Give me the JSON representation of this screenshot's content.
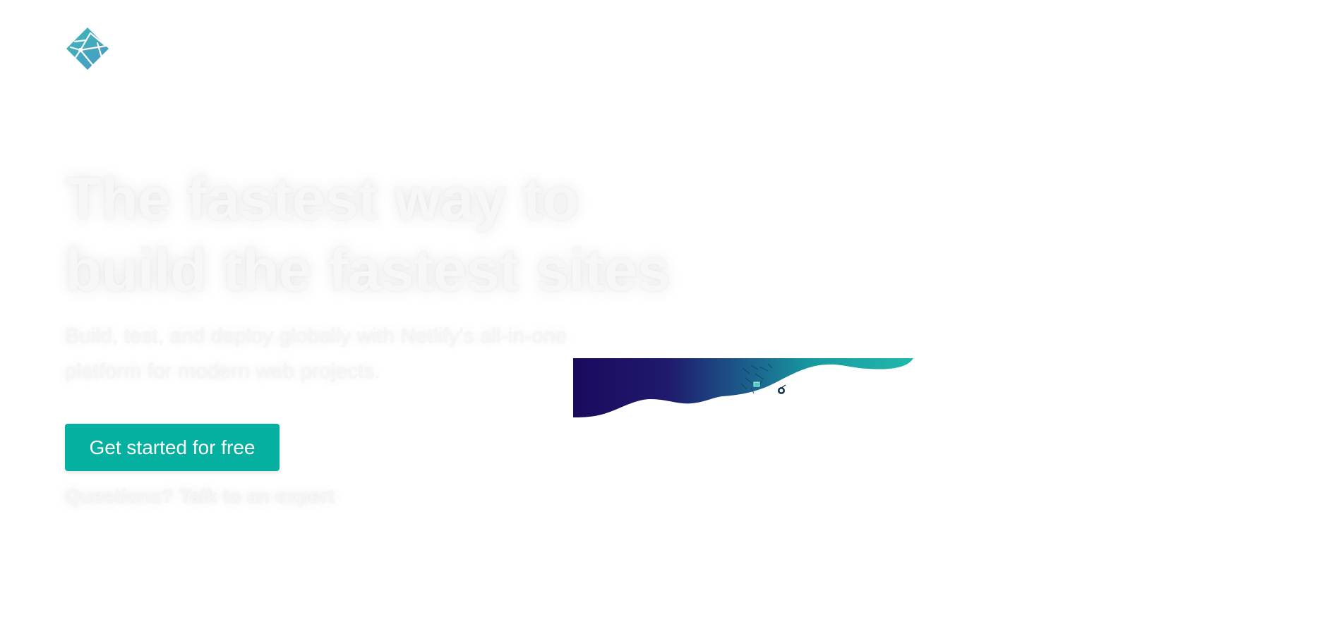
{
  "brand": {
    "logo_icon": "netlify-diamond-logo-icon",
    "primary_color": "#05b0a0",
    "logo_colors": [
      "#3fb5b8",
      "#4a9fc6"
    ]
  },
  "hero": {
    "title_line1": "The fastest way to",
    "title_line2": "build the fastest sites",
    "subtitle": "Build, test, and deploy globally with Netlify's all-in-one platform for modern web projects.",
    "cta_label": "Get started for free",
    "expert_link": "Questions? Talk to an expert"
  },
  "illustration": {
    "icon": "wave-deploy-illustration",
    "gradient": [
      "#1a0a5e",
      "#22b5aa"
    ]
  }
}
